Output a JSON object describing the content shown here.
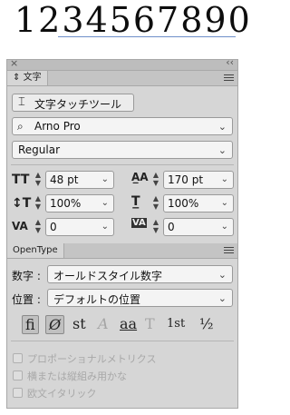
{
  "sample_text": "1234567890",
  "panel": {
    "title": "文字",
    "close_glyph": "×",
    "collapse_glyph": "‹‹",
    "touch_type_label": "文字タッチツール",
    "font_search_glyph": "⌕",
    "font_family": "Arno Pro",
    "font_style": "Regular",
    "font_size": "48 pt",
    "leading": "170 pt",
    "vertical_scale": "100%",
    "horizontal_scale": "100%",
    "kerning": "0",
    "tracking": "0"
  },
  "opentype": {
    "tab_label": "OpenType",
    "figure_label": "数字 :",
    "figure_value": "オールドスタイル数字",
    "position_label": "位置 :",
    "position_value": "デフォルトの位置",
    "glyphs": [
      "ﬁ",
      "Ø",
      "st",
      "A",
      "aa",
      "T",
      "1st",
      "½"
    ],
    "options": [
      "プロポーショナルメトリクス",
      "横または縦組み用かな",
      "欧文イタリック"
    ]
  }
}
